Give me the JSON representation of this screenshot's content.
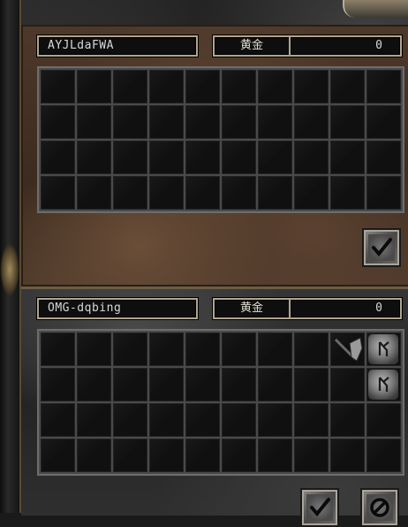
{
  "top_trader": {
    "name": "AYJLdaFWA",
    "gold_label": "黄金",
    "gold_value": "0"
  },
  "bottom_trader": {
    "name": "OMG-dqbing",
    "gold_label": "黄金",
    "gold_value": "0"
  },
  "top_grid": {
    "columns": 10,
    "rows": 4,
    "items": []
  },
  "bottom_grid": {
    "columns": 10,
    "rows": 4,
    "items": [
      {
        "row": 0,
        "col": 8,
        "icon": "throwing-axe-icon"
      },
      {
        "row": 0,
        "col": 9,
        "icon": "rune-icon"
      },
      {
        "row": 1,
        "col": 9,
        "icon": "rune-icon"
      }
    ]
  },
  "buttons": {
    "accept_top": {
      "icon": "checkmark-icon"
    },
    "accept_bottom": {
      "icon": "checkmark-icon"
    },
    "cancel": {
      "icon": "cancel-icon"
    }
  },
  "colors": {
    "field_border": "#b0a58e",
    "text": "#d8d8d8",
    "dirt_panel": "#4d3829",
    "stone_panel": "#2f2f2f"
  }
}
